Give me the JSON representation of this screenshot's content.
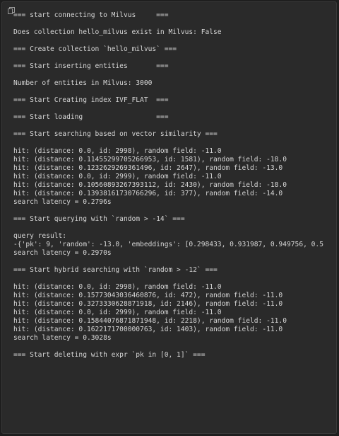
{
  "toolbar": {
    "copy_icon": "copy-icon"
  },
  "output": {
    "lines": [
      "=== start connecting to Milvus     ===",
      "",
      "Does collection hello_milvus exist in Milvus: False",
      "",
      "=== Create collection `hello_milvus` ===",
      "",
      "=== Start inserting entities       ===",
      "",
      "Number of entities in Milvus: 3000",
      "",
      "=== Start Creating index IVF_FLAT  ===",
      "",
      "=== Start loading                  ===",
      "",
      "=== Start searching based on vector similarity ===",
      "",
      "hit: (distance: 0.0, id: 2998), random field: -11.0",
      "hit: (distance: 0.11455299705266953, id: 1581), random field: -18.0",
      "hit: (distance: 0.1232629269361496, id: 2647), random field: -13.0",
      "hit: (distance: 0.0, id: 2999), random field: -11.0",
      "hit: (distance: 0.10560893267393112, id: 2430), random field: -18.0",
      "hit: (distance: 0.13938161730766296, id: 377), random field: -14.0",
      "search latency = 0.2796s",
      "",
      "=== Start querying with `random > -14` ===",
      "",
      "query result:",
      "-{'pk': 9, 'random': -13.0, 'embeddings': [0.298433, 0.931987, 0.949756, 0.5",
      "search latency = 0.2970s",
      "",
      "=== Start hybrid searching with `random > -12` ===",
      "",
      "hit: (distance: 0.0, id: 2998), random field: -11.0",
      "hit: (distance: 0.15773043036460876, id: 472), random field: -11.0",
      "hit: (distance: 0.3273330628871918, id: 2146), random field: -11.0",
      "hit: (distance: 0.0, id: 2999), random field: -11.0",
      "hit: (distance: 0.15844076871871948, id: 2218), random field: -11.0",
      "hit: (distance: 0.1622171700000763, id: 1403), random field: -11.0",
      "search latency = 0.3028s",
      "",
      "=== Start deleting with expr `pk in [0, 1]` ==="
    ]
  },
  "colors": {
    "background": "#1e1e1e",
    "panel": "#2a2a2a",
    "text": "#d6d6d6",
    "icon": "#9a9a9a"
  }
}
